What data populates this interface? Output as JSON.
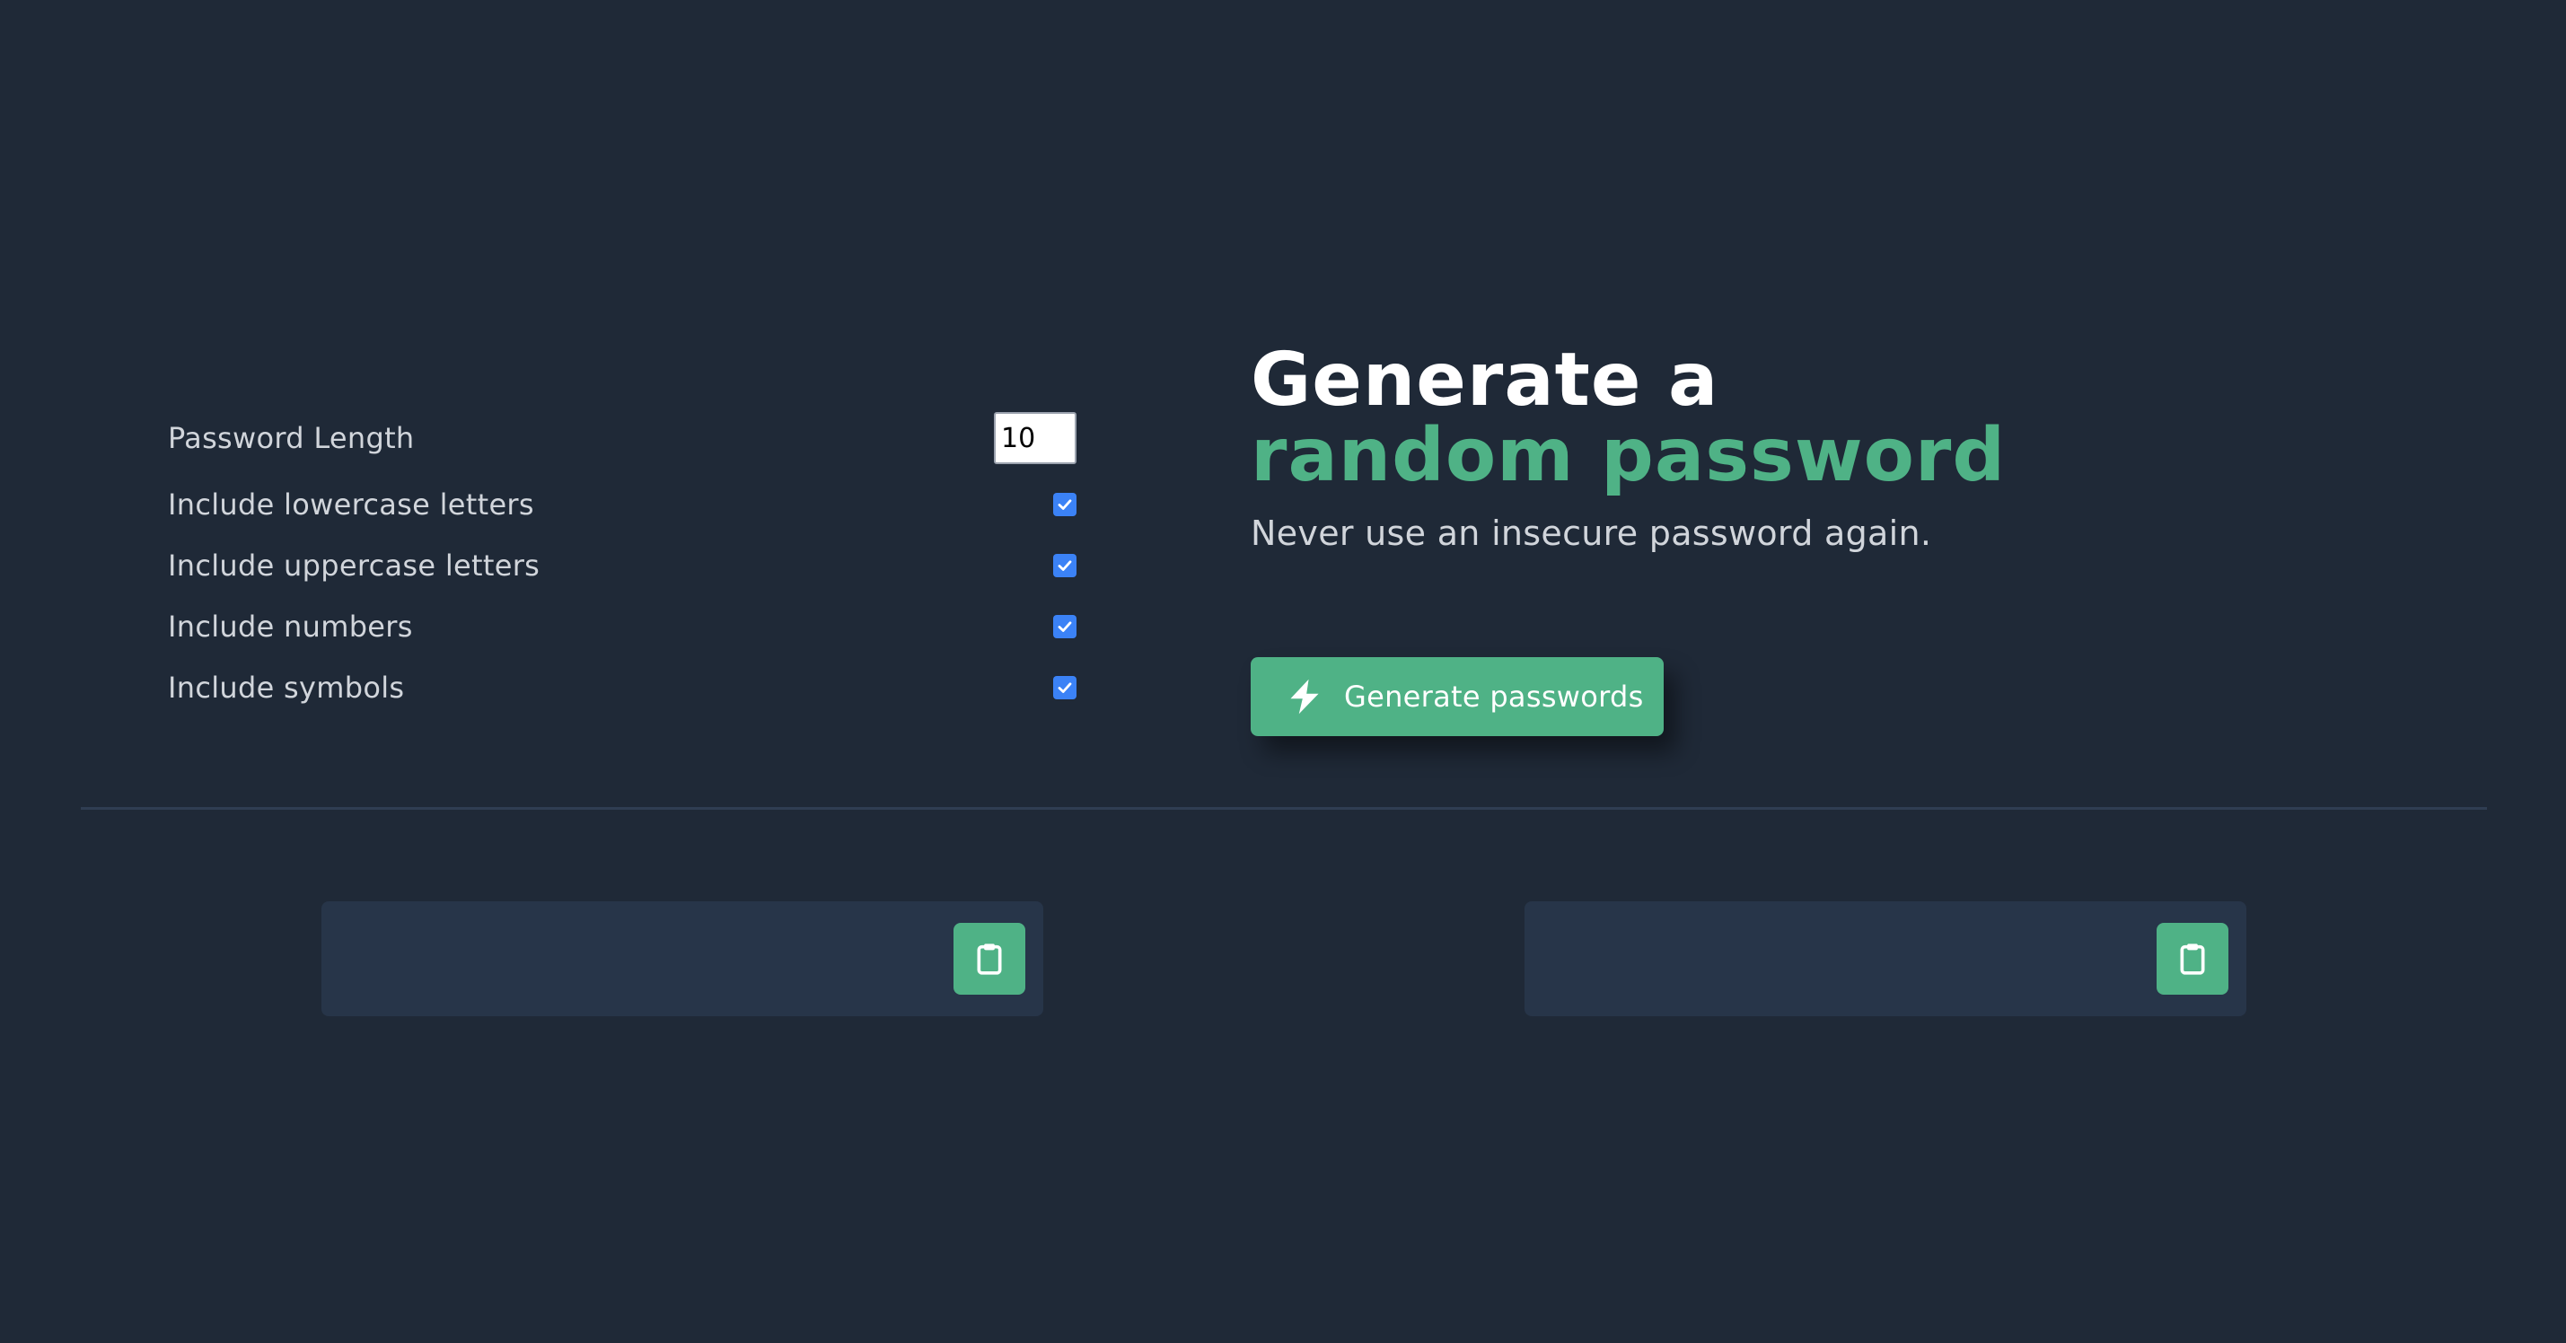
{
  "settings": {
    "length_label": "Password Length",
    "length_value": "10",
    "options": [
      {
        "label": "Include lowercase letters",
        "checked": true
      },
      {
        "label": "Include uppercase letters",
        "checked": true
      },
      {
        "label": "Include numbers",
        "checked": true
      },
      {
        "label": "Include symbols",
        "checked": true
      }
    ]
  },
  "hero": {
    "title_line1": "Generate a",
    "title_line2": "random password",
    "subtitle": "Never use an insecure password again."
  },
  "generate_button": {
    "label": "Generate passwords",
    "icon": "bolt-icon"
  },
  "passwords": [
    {
      "value": "",
      "copy_icon": "clipboard-icon"
    },
    {
      "value": "",
      "copy_icon": "clipboard-icon"
    }
  ],
  "colors": {
    "background": "#1f2937",
    "accent": "#4fb286",
    "panel": "#273549",
    "checkbox": "#3b82f6"
  }
}
